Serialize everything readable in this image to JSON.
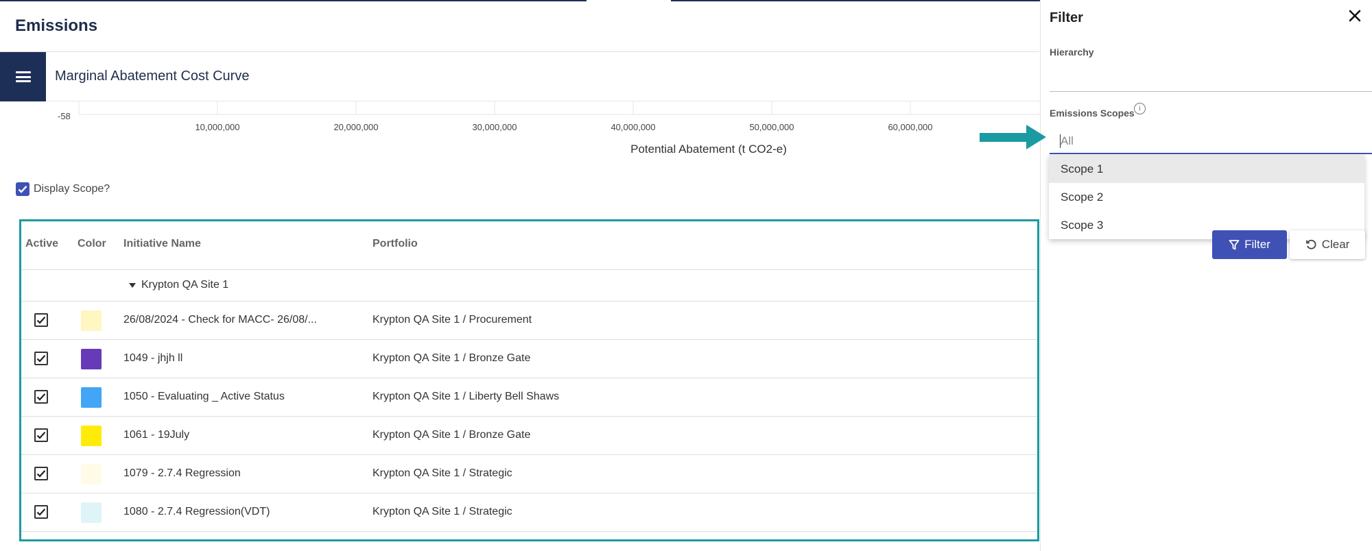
{
  "header": {
    "title": "Emissions"
  },
  "toolbar": {
    "title": "Marginal Abatement Cost Curve",
    "menu_icon": "hamburger-menu-icon"
  },
  "chart_data": {
    "type": "bar",
    "y_tick_label": "-58",
    "x_ticks": [
      "10,000,000",
      "20,000,000",
      "30,000,000",
      "40,000,000",
      "50,000,000",
      "60,000,000"
    ],
    "x_tick_values": [
      10000000,
      20000000,
      30000000,
      40000000,
      50000000,
      60000000
    ],
    "xlabel": "Potential Abatement (t CO2-e)",
    "grid": true
  },
  "display_scope": {
    "label": "Display Scope?",
    "checked": true
  },
  "table": {
    "columns": [
      "Active",
      "Color",
      "Initiative Name",
      "Portfolio"
    ],
    "group": "Krypton QA Site 1",
    "rows": [
      {
        "active": true,
        "color": "#fff6c2",
        "name": "26/08/2024 - Check for MACC- 26/08/...",
        "portfolio": "Krypton QA Site 1 / Procurement"
      },
      {
        "active": true,
        "color": "#673ab7",
        "name": "1049 - jhjh ll",
        "portfolio": "Krypton QA Site 1 / Bronze Gate"
      },
      {
        "active": true,
        "color": "#42a5f5",
        "name": "1050 - Evaluating _ Active Status",
        "portfolio": "Krypton QA Site 1 / Liberty Bell Shaws"
      },
      {
        "active": true,
        "color": "#ffeb0a",
        "name": "1061 - 19July",
        "portfolio": "Krypton QA Site 1 / Bronze Gate"
      },
      {
        "active": true,
        "color": "#fffbe6",
        "name": "1079 - 2.7.4 Regression",
        "portfolio": "Krypton QA Site 1 / Strategic"
      },
      {
        "active": true,
        "color": "#dff4f7",
        "name": "1080 - 2.7.4 Regression(VDT)",
        "portfolio": "Krypton QA Site 1 / Strategic"
      }
    ],
    "next_row_color": "#e8582c",
    "frame_color": "#1a9ba1"
  },
  "filter_panel": {
    "title": "Filter",
    "hierarchy_label": "Hierarchy",
    "scopes_label": "Emissions Scopes",
    "scopes_placeholder": "All",
    "options": [
      "Scope 1",
      "Scope 2",
      "Scope 3"
    ],
    "highlighted_option": "Scope 1",
    "filter_button": "Filter",
    "clear_button": "Clear"
  },
  "colors": {
    "brand": "#1e2f57",
    "accent": "#3f51b5",
    "annotation": "#1a9ba1"
  }
}
